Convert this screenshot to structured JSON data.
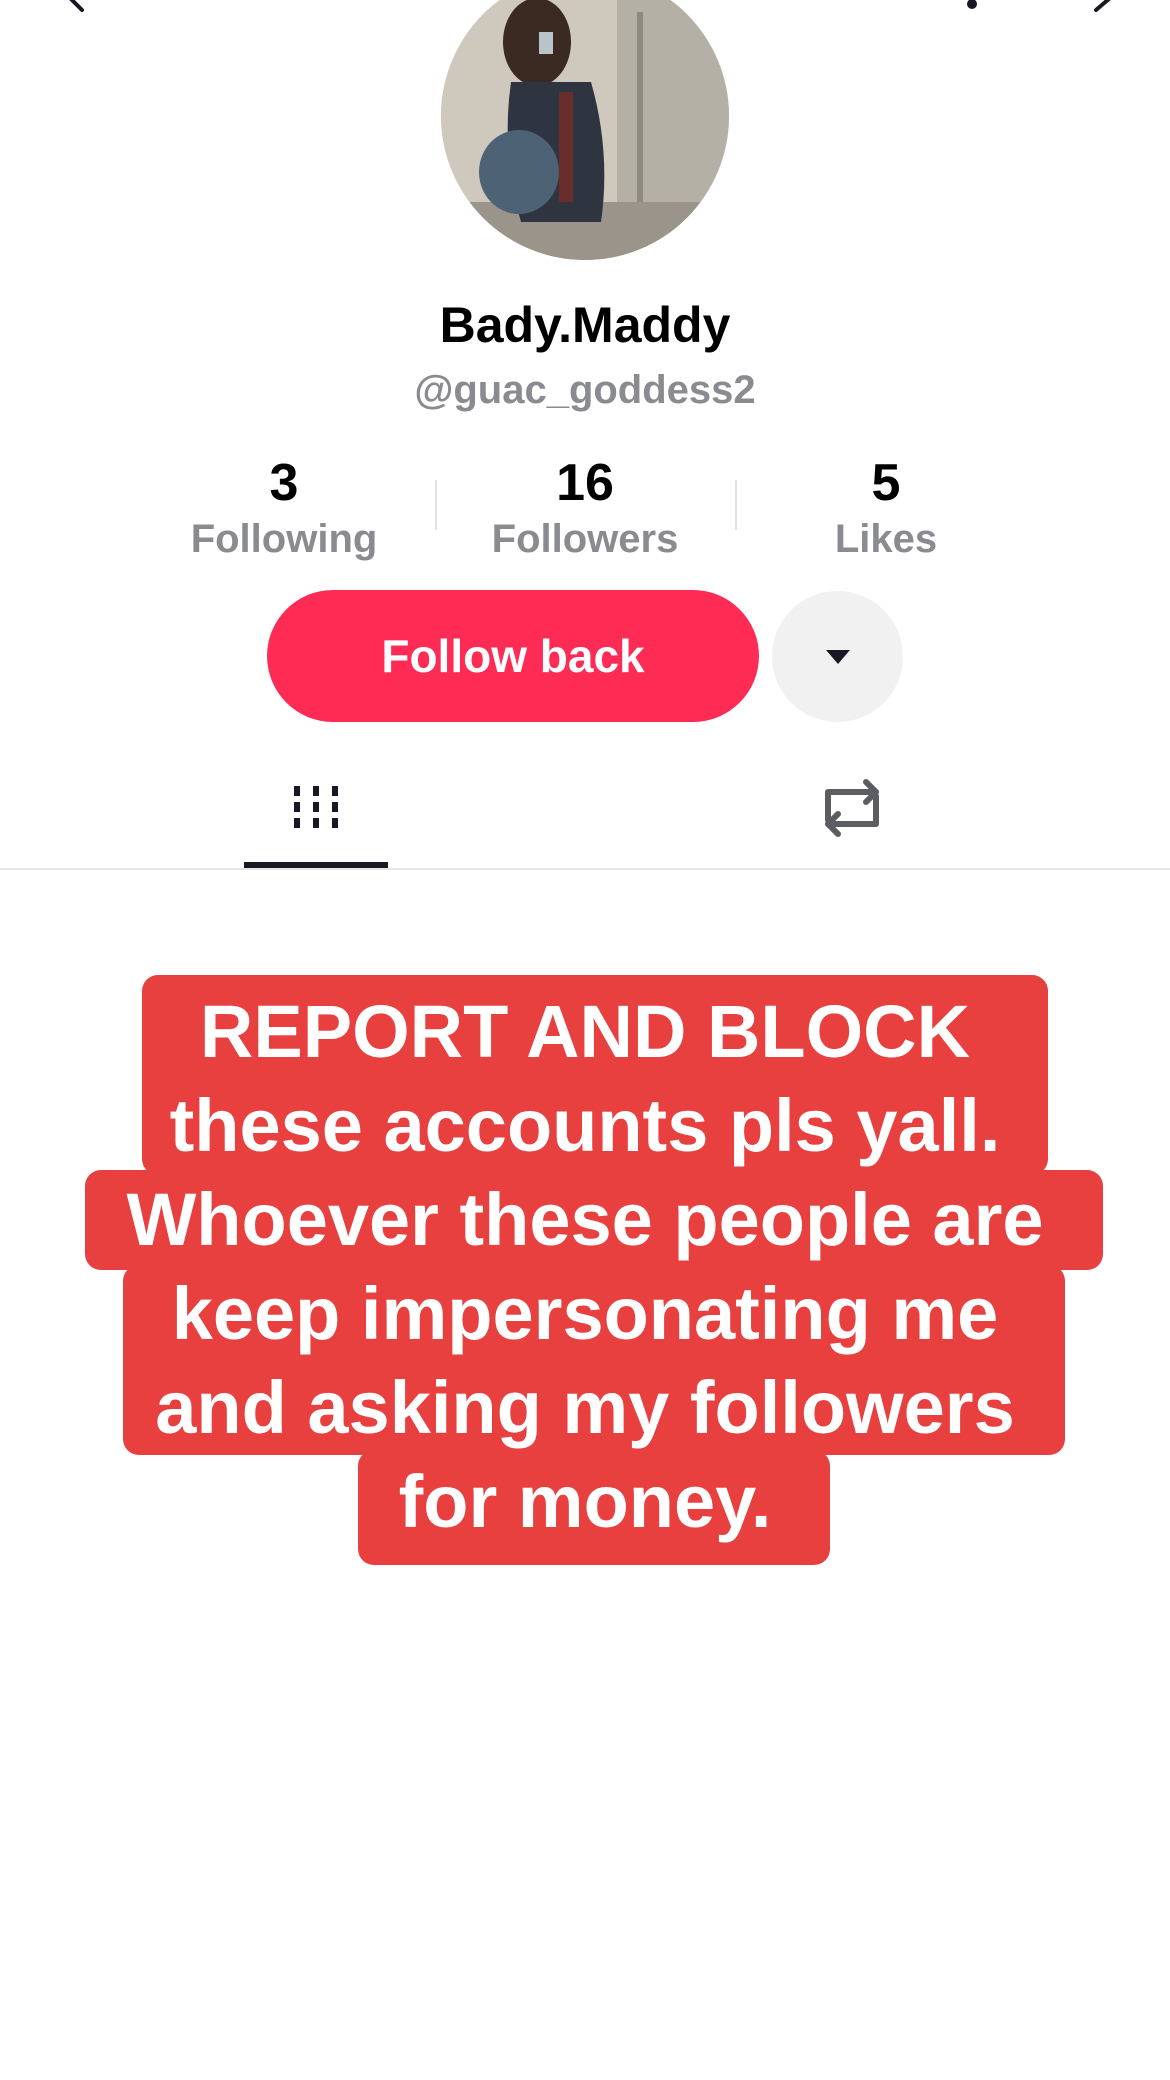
{
  "profile": {
    "display_name": "Bady.Maddy",
    "username": "@guac_goddess2"
  },
  "stats": [
    {
      "value": "3",
      "label": "Following"
    },
    {
      "value": "16",
      "label": "Followers"
    },
    {
      "value": "5",
      "label": "Likes"
    }
  ],
  "actions": {
    "follow_label": "Follow back",
    "more_icon": "caret-down-icon"
  },
  "tabs": [
    {
      "icon": "videos-grid-icon",
      "selected": true
    },
    {
      "icon": "repost-icon",
      "selected": false
    }
  ],
  "icons": {
    "back": "back-chevron-icon",
    "notifications": "bell-icon",
    "share": "share-icon"
  },
  "post_overlay": {
    "lines": [
      "REPORT AND BLOCK",
      "these accounts pls yall.",
      "Whoever these people are",
      "keep impersonating me",
      "and asking my followers",
      "for money."
    ],
    "background": "#e83f3f",
    "text_color": "#ffffff"
  },
  "colors": {
    "accent": "#fe2c55",
    "muted_text": "#8a8b91",
    "button_secondary": "#f1f1f2"
  }
}
